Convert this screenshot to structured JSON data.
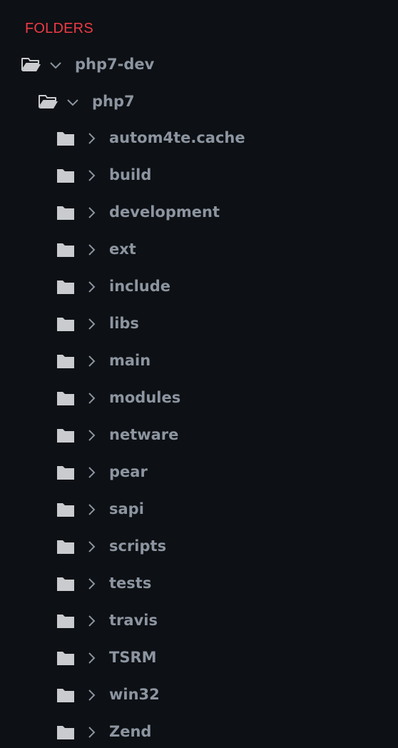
{
  "colors": {
    "background": "#0d1014",
    "header": "#ec3b45",
    "label": "#8c95a0",
    "icon": "#c9cbce",
    "chevron": "#8c95a0"
  },
  "header": {
    "title": "FOLDERS"
  },
  "tree": {
    "root": {
      "label": "php7-dev",
      "icon": "folder-open-icon",
      "expanded": true
    },
    "child": {
      "label": "php7",
      "icon": "folder-open-icon",
      "expanded": true
    },
    "items": [
      {
        "label": "autom4te.cache",
        "icon": "folder-icon",
        "expanded": false
      },
      {
        "label": "build",
        "icon": "folder-icon",
        "expanded": false
      },
      {
        "label": "development",
        "icon": "folder-icon",
        "expanded": false
      },
      {
        "label": "ext",
        "icon": "folder-icon",
        "expanded": false
      },
      {
        "label": "include",
        "icon": "folder-icon",
        "expanded": false
      },
      {
        "label": "libs",
        "icon": "folder-icon",
        "expanded": false
      },
      {
        "label": "main",
        "icon": "folder-icon",
        "expanded": false
      },
      {
        "label": "modules",
        "icon": "folder-icon",
        "expanded": false
      },
      {
        "label": "netware",
        "icon": "folder-icon",
        "expanded": false
      },
      {
        "label": "pear",
        "icon": "folder-icon",
        "expanded": false
      },
      {
        "label": "sapi",
        "icon": "folder-icon",
        "expanded": false
      },
      {
        "label": "scripts",
        "icon": "folder-icon",
        "expanded": false
      },
      {
        "label": "tests",
        "icon": "folder-icon",
        "expanded": false
      },
      {
        "label": "travis",
        "icon": "folder-icon",
        "expanded": false
      },
      {
        "label": "TSRM",
        "icon": "folder-icon",
        "expanded": false
      },
      {
        "label": "win32",
        "icon": "folder-icon",
        "expanded": false
      },
      {
        "label": "Zend",
        "icon": "folder-icon",
        "expanded": false
      }
    ]
  }
}
